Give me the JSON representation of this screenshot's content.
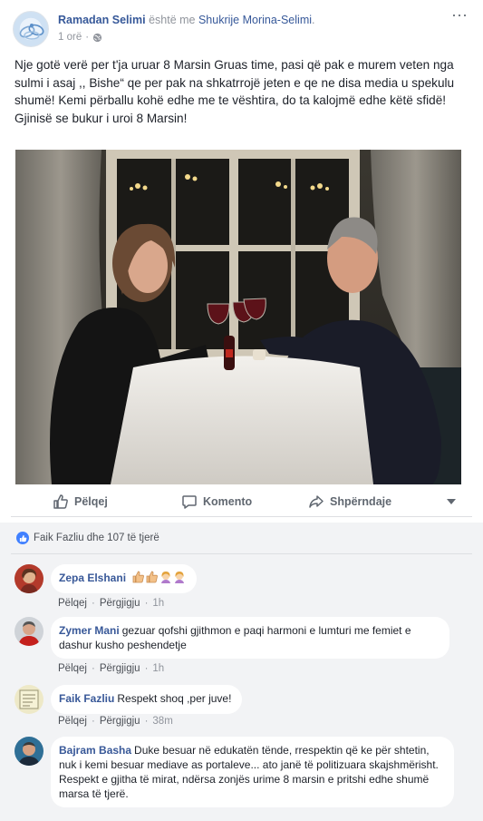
{
  "post": {
    "author": "Ramadan Selimi",
    "with_text": "është me",
    "tagged": "Shukrije Morina-Selimi",
    "period": ".",
    "time": "1 orë",
    "dot": "·",
    "options": "···",
    "text_lines": [
      "Nje gotë verë per t'ja uruar 8 Marsin Gruas time, pasi që pak e murem veten nga sulmi i asaj ,, Bishe“ qe per pak na shkatrrojë jeten e qe ne disa media u spekulu shumë! Kemi përballu kohë edhe me te vështira, do ta kalojmë edhe këtë sfidë!",
      "Gjinisë se bukur i uroi 8 Marsin!"
    ]
  },
  "actions": {
    "like": "Pëlqej",
    "comment": "Komento",
    "share": "Shpërndaje"
  },
  "reactions": {
    "text": "Faik Fazliu dhe 107 të tjerë"
  },
  "comment_actions": {
    "like": "Pëlqej",
    "reply": "Përgjigju",
    "dot": "·"
  },
  "comments": [
    {
      "name": "Zepa Elshani",
      "text": "",
      "time": "1h"
    },
    {
      "name": "Zymer Mani",
      "text": "gezuar qofshi gjithmon e paqi harmoni e lumturi me femiet e dashur kusho peshendetje",
      "time": "1h"
    },
    {
      "name": "Faik Fazliu",
      "text": "Respekt shoq ,per juve!",
      "time": "38m"
    },
    {
      "name": "Bajram Basha",
      "text": "Duke besuar në edukatën tënde, rrespektin që ke për shtetin, nuk i kemi besuar mediave as portaleve... ato janë të politizuara skajshmërisht.",
      "text2": "Respekt e gjitha të mirat, ndërsa zonjës urime 8 marsin e pritshi edhe shumë marsa të tjerë."
    }
  ],
  "colors": {
    "link": "#365899",
    "muted": "#90949c",
    "comment_bg": "#f2f3f5",
    "like_blue": "#4080ff"
  }
}
